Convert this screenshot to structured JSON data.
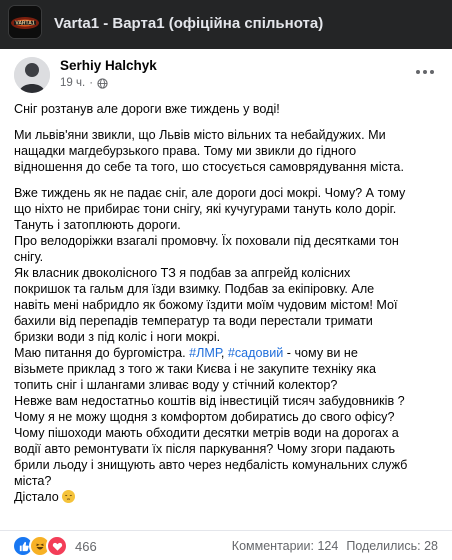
{
  "group": {
    "title": "Varta1 - Варта1 (офіційна спільнота)",
    "avatar_icon": "varta1-logo-icon"
  },
  "post": {
    "author": "Serhiy Halchyk",
    "time": "19 ч.",
    "audience_icon": "globe-icon",
    "paragraphs": [
      "Сніг розтанув але дороги вже тиждень у воді!",
      "Ми львів'яни звикли, що Львів місто вільних та небайдужих. Ми\nнащадки магдебурзького права. Тому ми звикли до гідного\nвідношення до себе та того, шо стосується самоврядування міста.",
      "Вже тиждень як не падає сніг, але дороги досі мокрі. Чому? А тому\nщо ніхто не прибирає тони снігу, які кучугурами тануть коло доріг.\nТануть і затоплюють дороги.\nПро велодоріжки взагалі промовчу. Їх поховали під десятками тон\nснігу.\nЯк власник двоколісного ТЗ я подбав за апгрейд колісних\nпокришок та гальм для їзди взимку. Подбав за екіпіровку. Але\nнавіть мені набридло як божому їздити моїм чудовим містом! Мої\nбахили від перепадів температур та води перестали тримати\nбризки води з під коліс і ноги мокрі.",
      "Маю питання до бургомістра.",
      "#ЛМР",
      ", ",
      "#садовий",
      "  - чому ви не\nвізьмете приклад з того ж таки Києва і не закупите техніку яка\nтопить сніг і шлангами зливає воду у стічний колектор?\nНевже вам недостатньо коштів від інвестицій тисяч забудовників ?\nЧому я не можу щодня з комфортом добиратись до свого офісу?\nЧому  пішоходи мають обходити десятки метрів води на дорогах а\nводії авто ремонтувати їх після паркування? Чому згори падають\nбрили льоду і знищують авто через недбалість комунальних служб\nміста?\nДістало"
    ],
    "emoji": "pensive-face-icon"
  },
  "footer": {
    "reaction_icons": [
      "like-icon",
      "haha-icon",
      "love-icon"
    ],
    "reaction_count": "466",
    "comments": "Комментарии: 124",
    "shares": "Поделились: 28"
  },
  "colors": {
    "header_bg": "#242526",
    "link": "#216fdb",
    "like": "#1877f2",
    "love": "#f33e58",
    "haha": "#f7b125"
  }
}
